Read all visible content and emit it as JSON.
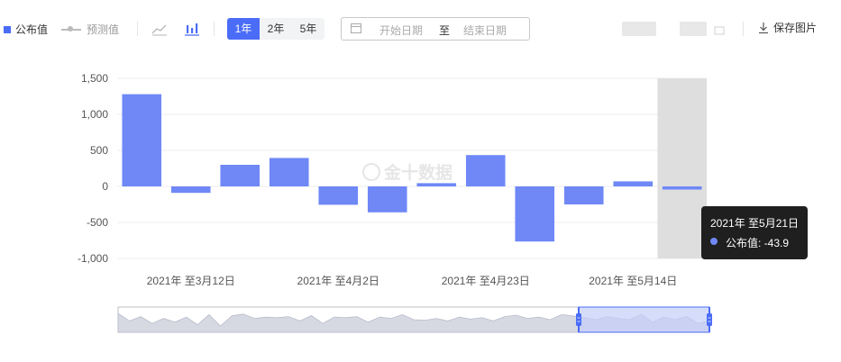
{
  "legend": {
    "published_label": "公布值",
    "forecast_label": "预测值",
    "line_icon": "line-chart-icon",
    "bar_icon": "bar-chart-icon"
  },
  "range_buttons": [
    "1年",
    "2年",
    "5年"
  ],
  "active_range": "1年",
  "date_range": {
    "start_placeholder": "开始日期",
    "separator": "至",
    "end_placeholder": "结束日期"
  },
  "save_label": "保存图片",
  "watermark": "金十数据",
  "colors": {
    "bar": "#6f88f6",
    "accent": "#4a6cf7",
    "highlight_band": "#dedede",
    "navigator_fill": "#d6d8e2",
    "navigator_selected": "#c5cffa"
  },
  "chart_data": {
    "type": "bar",
    "series": [
      {
        "name": "公布值",
        "values": [
          1280,
          -90,
          300,
          395,
          -255,
          -360,
          45,
          435,
          -765,
          -250,
          70,
          -43.9
        ]
      }
    ],
    "ylim": [
      -1000,
      1500
    ],
    "yticks": [
      "1,500",
      "1,000",
      "500",
      "0",
      "-500",
      "-1,000"
    ],
    "ytick_values": [
      1500,
      1000,
      500,
      0,
      -500,
      -1000
    ],
    "x_labels": [
      {
        "index": 1,
        "label": "2021年 至3月12日"
      },
      {
        "index": 4,
        "label": "2021年 至4月2日"
      },
      {
        "index": 7,
        "label": "2021年 至4月23日"
      },
      {
        "index": 10,
        "label": "2021年 至5月14日"
      }
    ],
    "highlighted_index": 11,
    "grid": true
  },
  "tooltip": {
    "title": "2021年 至5月21日",
    "row": "公布值: -43.9"
  }
}
